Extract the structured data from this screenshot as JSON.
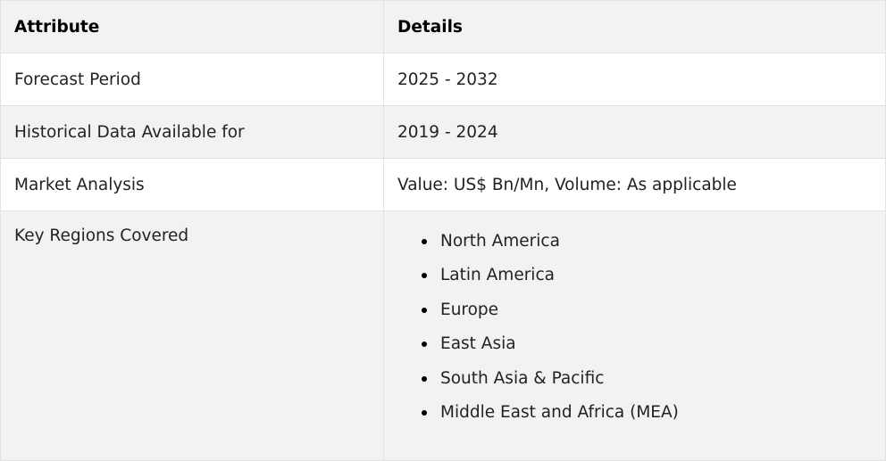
{
  "table": {
    "headers": {
      "attribute": "Attribute",
      "details": "Details"
    },
    "rows": [
      {
        "attribute": "Forecast Period",
        "details": "2025 - 2032"
      },
      {
        "attribute": "Historical Data Available for",
        "details": "2019 - 2024"
      },
      {
        "attribute": "Market Analysis",
        "details": "Value: US$ Bn/Mn, Volume: As applicable"
      }
    ],
    "regions": {
      "attribute": "Key Regions Covered",
      "items": [
        "North America",
        "Latin America",
        "Europe",
        "East Asia",
        "South Asia & Pacific",
        "Middle East and Africa (MEA)"
      ]
    }
  },
  "colors": {
    "header_bg": "#f2f2f2",
    "alt_row_bg": "#f2f2f2",
    "border": "#e2e2e2",
    "text": "#222222"
  }
}
